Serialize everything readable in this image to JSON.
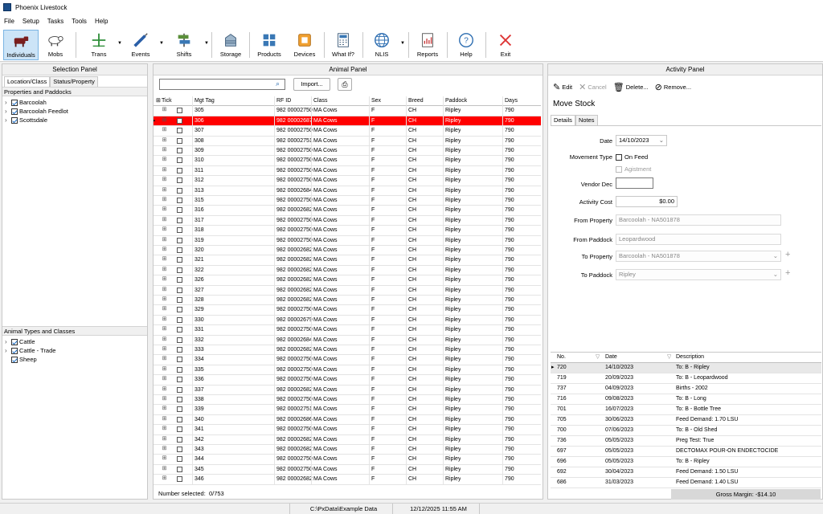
{
  "window": {
    "title": "Phoenix Livestock"
  },
  "menu": [
    "File",
    "Setup",
    "Tasks",
    "Tools",
    "Help"
  ],
  "toolbar": [
    {
      "label": "Individuals",
      "icon": "cow-icon"
    },
    {
      "label": "Mobs",
      "icon": "sheep-icon"
    },
    {
      "label": "Trans",
      "icon": "plus-icon"
    },
    {
      "label": "Events",
      "icon": "syringe-icon"
    },
    {
      "label": "Shifts",
      "icon": "signpost-icon"
    },
    {
      "label": "Storage",
      "icon": "silo-icon"
    },
    {
      "label": "Products",
      "icon": "products-icon"
    },
    {
      "label": "Devices",
      "icon": "device-icon"
    },
    {
      "label": "What If?",
      "icon": "calculator-icon"
    },
    {
      "label": "NLIS",
      "icon": "globe-icon"
    },
    {
      "label": "Reports",
      "icon": "report-icon"
    },
    {
      "label": "Help",
      "icon": "help-icon"
    },
    {
      "label": "Exit",
      "icon": "exit-icon"
    }
  ],
  "selection_panel": {
    "title": "Selection Panel",
    "tabs": [
      "Location/Class",
      "Status/Property"
    ],
    "section1": "Properties and Paddocks",
    "properties": [
      "Barcoolah",
      "Barcoolah Feedlot",
      "Scottsdale"
    ],
    "section2": "Animal Types and Classes",
    "types": [
      "Cattle",
      "Cattle - Trade",
      "Sheep"
    ]
  },
  "animal_panel": {
    "title": "Animal Panel",
    "import_label": "Import...",
    "columns": [
      "Tick",
      "Mgt Tag",
      "RF ID",
      "Class",
      "Sex",
      "Breed",
      "Paddock",
      "Days"
    ],
    "rows": [
      [
        "305",
        "982 00002750"
      ],
      [
        "306",
        "982 00002687"
      ],
      [
        "307",
        "982 00002750"
      ],
      [
        "308",
        "982 00002751"
      ],
      [
        "309",
        "982 00002750"
      ],
      [
        "310",
        "982 00002750"
      ],
      [
        "311",
        "982 00002750"
      ],
      [
        "312",
        "982 00002750"
      ],
      [
        "313",
        "982 00002684"
      ],
      [
        "315",
        "982 00002750"
      ],
      [
        "316",
        "982 00002682"
      ],
      [
        "317",
        "982 00002750"
      ],
      [
        "318",
        "982 00002750"
      ],
      [
        "319",
        "982 00002750"
      ],
      [
        "320",
        "982 00002682"
      ],
      [
        "321",
        "982 00002682"
      ],
      [
        "322",
        "982 00002682"
      ],
      [
        "326",
        "982 00002682"
      ],
      [
        "327",
        "982 00002682"
      ],
      [
        "328",
        "982 00002682"
      ],
      [
        "329",
        "982 00002750"
      ],
      [
        "330",
        "982 00002679"
      ],
      [
        "331",
        "982 00002750"
      ],
      [
        "332",
        "982 00002684"
      ],
      [
        "333",
        "982 00002682"
      ],
      [
        "334",
        "982 00002750"
      ],
      [
        "335",
        "982 00002750"
      ],
      [
        "336",
        "982 00002750"
      ],
      [
        "337",
        "982 00002682"
      ],
      [
        "338",
        "982 00002750"
      ],
      [
        "339",
        "982 00002751"
      ],
      [
        "340",
        "982 00002686"
      ],
      [
        "341",
        "982 00002750"
      ],
      [
        "342",
        "982 00002682"
      ],
      [
        "343",
        "982 00002682"
      ],
      [
        "344",
        "982 00002750"
      ],
      [
        "345",
        "982 00002750"
      ],
      [
        "346",
        "982 00002682"
      ]
    ],
    "row_class": "MA Cows",
    "row_sex": "F",
    "row_breed": "CH",
    "row_paddock": "Ripley",
    "row_days": "790",
    "selected_tag": "306",
    "footer_label": "Number selected:",
    "footer_value": "0/753"
  },
  "activity_panel": {
    "title": "Activity Panel",
    "actions": [
      {
        "label": "Edit",
        "icon": "pencil-icon",
        "enabled": true
      },
      {
        "label": "Cancel",
        "icon": "cancel-icon",
        "enabled": false
      },
      {
        "label": "Delete...",
        "icon": "trash-icon",
        "enabled": true
      },
      {
        "label": "Remove...",
        "icon": "remove-icon",
        "enabled": true
      }
    ],
    "heading": "Move Stock",
    "tabs": [
      "Details",
      "Notes"
    ],
    "form": {
      "date_label": "Date",
      "date_value": "14/10/2023",
      "movement_label": "Movement Type",
      "on_feed": "On Feed",
      "agistment": "Agistment",
      "vendor_label": "Vendor Dec",
      "vendor_value": "",
      "cost_label": "Activity Cost",
      "cost_value": "$0.00",
      "from_property_label": "From Property",
      "from_property_value": "Barcoolah - NA501878",
      "from_paddock_label": "From Paddock",
      "from_paddock_value": "Leopardwood",
      "to_property_label": "To Property",
      "to_property_value": "Barcoolah - NA501878",
      "to_paddock_label": "To Paddock",
      "to_paddock_value": "Ripley"
    },
    "history_columns": [
      "No.",
      "Date",
      "Description"
    ],
    "history": [
      [
        "720",
        "14/10/2023",
        "To: B - Ripley"
      ],
      [
        "719",
        "20/09/2023",
        "To: B - Leopardwood"
      ],
      [
        "737",
        "04/09/2023",
        "Births - 2002"
      ],
      [
        "716",
        "09/08/2023",
        "To: B - Long"
      ],
      [
        "701",
        "16/07/2023",
        "To: B - Bottle Tree"
      ],
      [
        "705",
        "30/06/2023",
        "Feed Demand: 1.70 LSU"
      ],
      [
        "700",
        "07/06/2023",
        "To: B - Old Shed"
      ],
      [
        "736",
        "05/05/2023",
        "Preg Test: True"
      ],
      [
        "697",
        "05/05/2023",
        "DECTOMAX POUR-ON ENDECTOCIDE"
      ],
      [
        "696",
        "05/05/2023",
        "To: B - Ripley"
      ],
      [
        "692",
        "30/04/2023",
        "Feed Demand: 1.50 LSU"
      ],
      [
        "686",
        "31/03/2023",
        "Feed Demand: 1.40 LSU"
      ]
    ],
    "gross_margin": "Gross Margin: -$14.10"
  },
  "status_bar": {
    "path": "C:\\PxData\\Example Data",
    "datetime": "12/12/2025  11:55 AM"
  },
  "colors": {
    "selected_row": "#ff0000",
    "active_tool": "#cce4f7",
    "accent": "#1a6dc7"
  }
}
